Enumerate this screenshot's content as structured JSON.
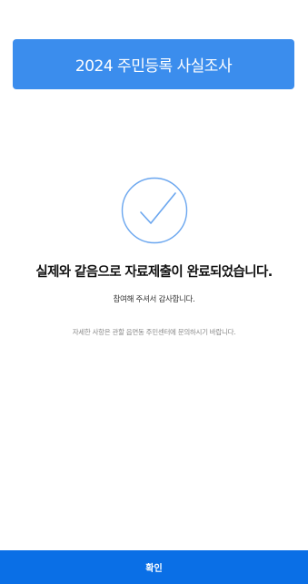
{
  "header": {
    "title": "2024 주민등록 사실조사",
    "background_color": "#3b8ded"
  },
  "status": {
    "icon": "check-circle-icon",
    "icon_color": "#6aa6ef",
    "message": "실제와 같음으로 자료제출이 완료되었습니다.",
    "thanks": "참여해 주셔서 감사합니다.",
    "info": "자세한 사항은 관할 읍면동 주민센터에 문의하시기 바랍니다."
  },
  "footer": {
    "confirm_label": "확인",
    "button_color": "#0a6fe6"
  }
}
